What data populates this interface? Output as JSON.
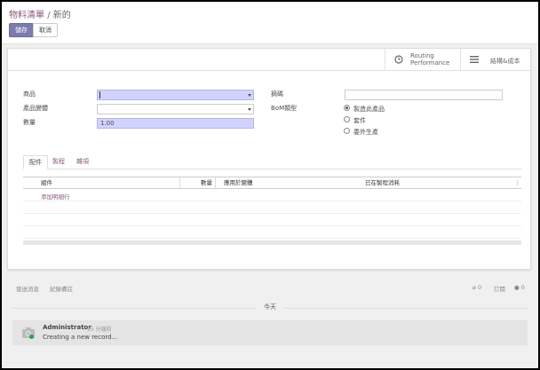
{
  "breadcrumb": {
    "parent": "物料清單",
    "separator": "/",
    "current": "新的"
  },
  "buttons": {
    "save": "儲存",
    "discard": "取消"
  },
  "smart_buttons": [
    {
      "icon": "clock-icon",
      "label_line1": "Routing",
      "label_line2": "Performance"
    },
    {
      "icon": "bars-icon",
      "label": "結構&成本"
    }
  ],
  "form": {
    "product": {
      "label": "商品",
      "value": "",
      "required": true
    },
    "variant": {
      "label": "產品變體",
      "value": ""
    },
    "quantity": {
      "label": "數量",
      "value": "1.00",
      "required": true
    },
    "reference": {
      "label": "摘碼",
      "value": ""
    },
    "bom_type": {
      "label": "BoM類型",
      "options": [
        "製造此產品",
        "套件",
        "委外生產"
      ],
      "selected": 0
    }
  },
  "tabs": [
    "配件",
    "製程",
    "雜項"
  ],
  "active_tab": 0,
  "components_table": {
    "columns": [
      "組件",
      "數量",
      "應用於變體",
      "已在製程消耗"
    ],
    "add_line": "添加明細行"
  },
  "chatter": {
    "send_message": "發送消息",
    "log_note": "紀錄備註",
    "attachments": "0",
    "follow": "訂閱",
    "followers": "0",
    "day_separator": "今天",
    "messages": [
      {
        "author": "Administrator",
        "ago": "- 25 分鐘前",
        "body": "Creating a new record..."
      }
    ]
  },
  "colors": {
    "primary": "#7c7bad",
    "link": "#875a7b",
    "required_bg": "#d2d2ff"
  }
}
